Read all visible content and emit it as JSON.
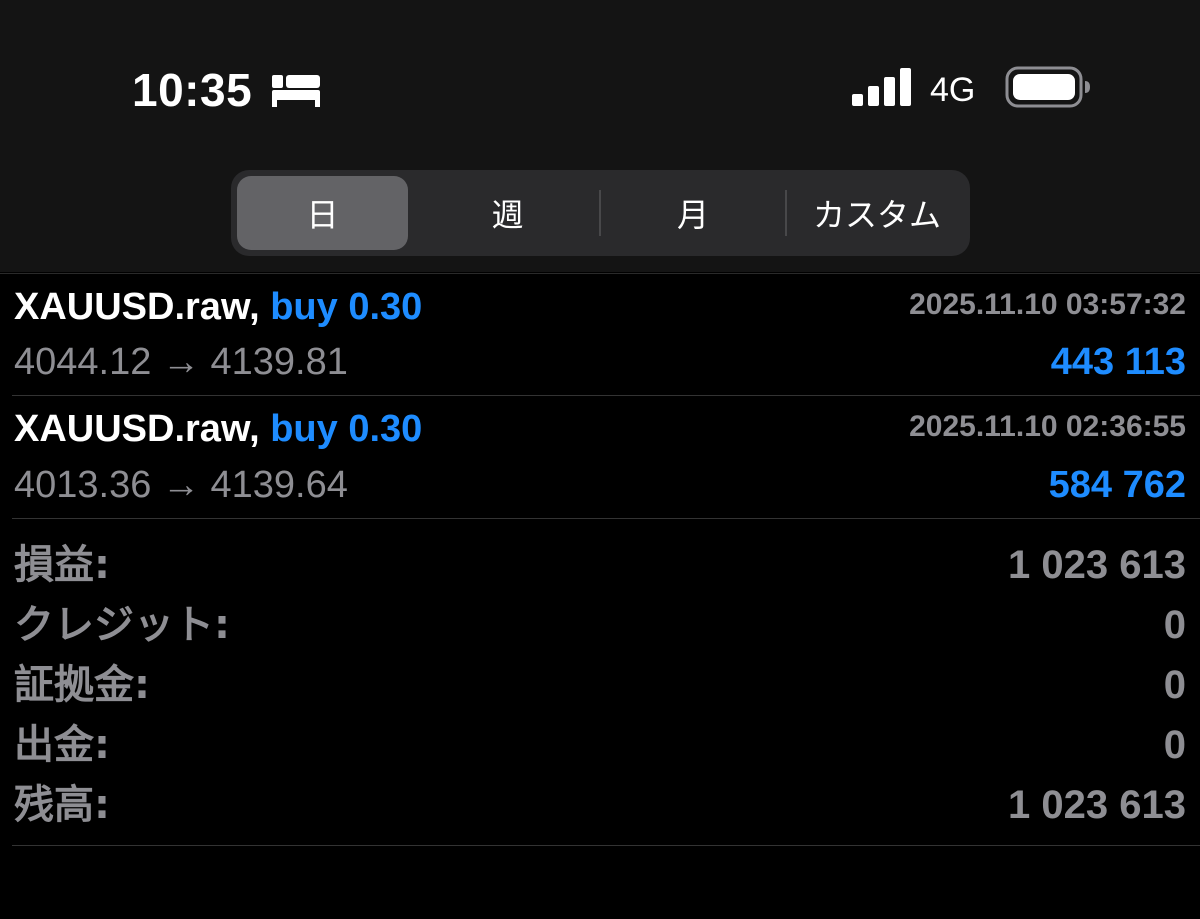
{
  "status_bar": {
    "time": "10:35",
    "network": "4G",
    "icons": [
      "bed-icon",
      "signal-icon",
      "battery-icon"
    ]
  },
  "period_tabs": [
    {
      "label": "日",
      "selected": true
    },
    {
      "label": "週",
      "selected": false
    },
    {
      "label": "月",
      "selected": false
    },
    {
      "label": "カスタム",
      "selected": false
    }
  ],
  "trades": [
    {
      "symbol": "XAUUSD.raw,",
      "side": "buy 0.30",
      "datetime": "2025.11.10 03:57:32",
      "open_price": "4044.12",
      "arrow": "→",
      "close_price": "4139.81",
      "profit": "443 113"
    },
    {
      "symbol": "XAUUSD.raw,",
      "side": "buy 0.30",
      "datetime": "2025.11.10 02:36:55",
      "open_price": "4013.36",
      "arrow": "→",
      "close_price": "4139.64",
      "profit": "584 762"
    }
  ],
  "summary": [
    {
      "label": "損益:",
      "value": "1 023 613"
    },
    {
      "label": "クレジット:",
      "value": "0"
    },
    {
      "label": "証拠金:",
      "value": "0"
    },
    {
      "label": "出金:",
      "value": "0"
    },
    {
      "label": "残高:",
      "value": "1 023 613"
    }
  ],
  "colors": {
    "accent_blue": "#1e8cff",
    "secondary_text": "#8e8e93",
    "background": "#000000",
    "header_background": "#141414"
  }
}
